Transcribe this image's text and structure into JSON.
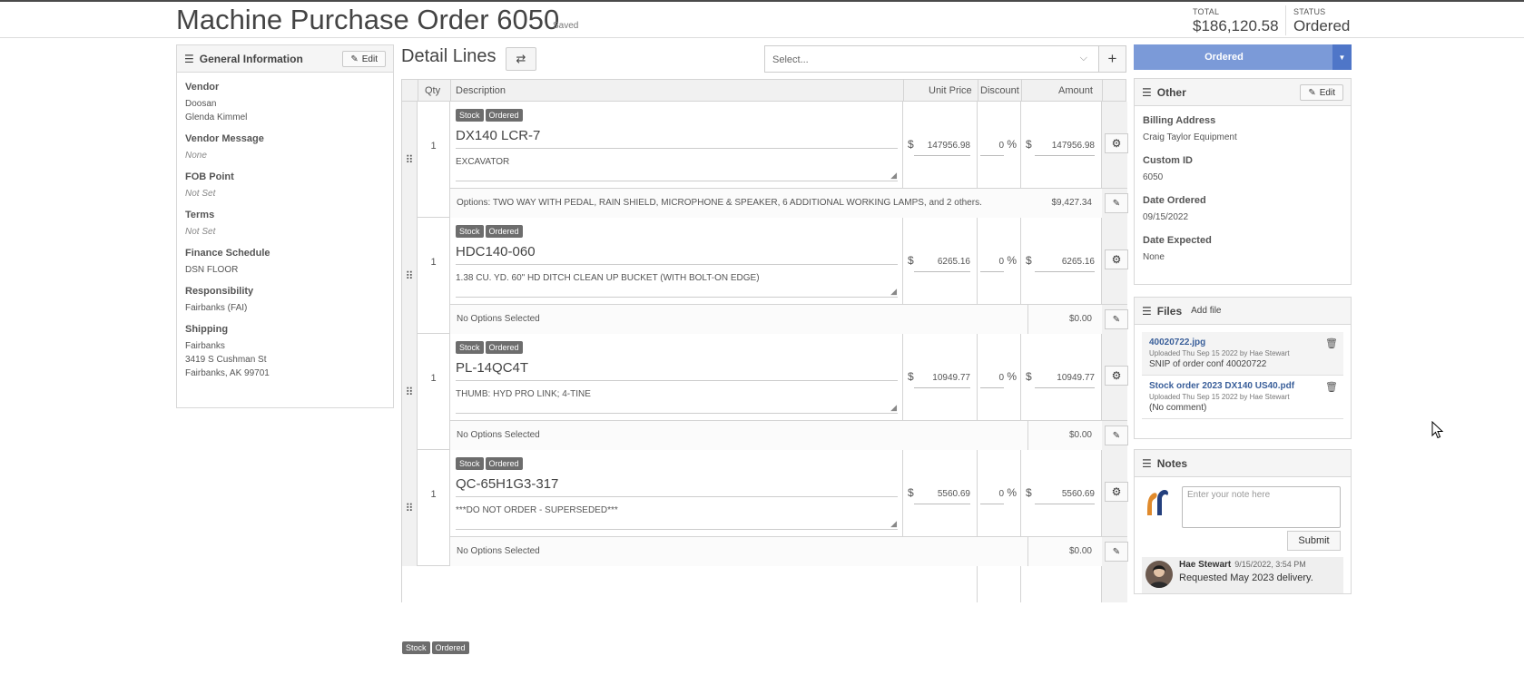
{
  "header": {
    "title": "Machine Purchase Order 6050",
    "saved": "Saved",
    "total_label": "TOTAL",
    "total_value": "$186,120.58",
    "status_label": "STATUS",
    "status_value": "Ordered"
  },
  "general": {
    "title": "General Information",
    "edit": "Edit",
    "vendor_label": "Vendor",
    "vendor_name": "Doosan",
    "vendor_contact": "Glenda Kimmel",
    "vendor_msg_label": "Vendor Message",
    "vendor_msg": "None",
    "fob_label": "FOB Point",
    "fob": "Not Set",
    "terms_label": "Terms",
    "terms": "Not Set",
    "finance_label": "Finance Schedule",
    "finance": "DSN FLOOR",
    "resp_label": "Responsibility",
    "resp": "Fairbanks (FAI)",
    "ship_label": "Shipping",
    "ship_1": "Fairbanks",
    "ship_2": "3419 S Cushman St",
    "ship_3": "Fairbanks, AK 99701"
  },
  "detail": {
    "title": "Detail Lines",
    "select_placeholder": "Select...",
    "columns": {
      "qty": "Qty",
      "description": "Description",
      "unit_price": "Unit Price",
      "discount": "Discount",
      "amount": "Amount"
    },
    "badges": [
      "Stock",
      "Ordered"
    ],
    "items": [
      {
        "qty": "1",
        "part": "DX140 LCR-7",
        "desc": "EXCAVATOR",
        "unit_price": "147956.98",
        "discount": "0",
        "amount": "147956.98",
        "options": "Options: TWO WAY WITH PEDAL, RAIN SHIELD, MICROPHONE & SPEAKER, 6 ADDITIONAL WORKING LAMPS, and 2 others.",
        "options_amount": "$9,427.34"
      },
      {
        "qty": "1",
        "part": "HDC140-060",
        "desc": "1.38 CU. YD. 60\" HD DITCH CLEAN UP BUCKET (WITH BOLT-ON EDGE)",
        "unit_price": "6265.16",
        "discount": "0",
        "amount": "6265.16",
        "options": "No Options Selected",
        "options_amount": "$0.00"
      },
      {
        "qty": "1",
        "part": "PL-14QC4T",
        "desc": "THUMB: HYD PRO LINK; 4-TINE",
        "unit_price": "10949.77",
        "discount": "0",
        "amount": "10949.77",
        "options": "No Options Selected",
        "options_amount": "$0.00"
      },
      {
        "qty": "1",
        "part": "QC-65H1G3-317",
        "desc": "***DO NOT ORDER - SUPERSEDED***",
        "unit_price": "5560.69",
        "discount": "0",
        "amount": "5560.69",
        "options": "No Options Selected",
        "options_amount": "$0.00"
      }
    ],
    "currency": "$",
    "percent": "%"
  },
  "status_button": "Ordered",
  "other": {
    "title": "Other",
    "edit": "Edit",
    "billing_label": "Billing Address",
    "billing": "Craig Taylor Equipment",
    "custom_id_label": "Custom ID",
    "custom_id": "6050",
    "date_ordered_label": "Date Ordered",
    "date_ordered": "09/15/2022",
    "date_expected_label": "Date Expected",
    "date_expected": "None"
  },
  "files": {
    "title": "Files",
    "add": "Add file",
    "list": [
      {
        "name": "40020722.jpg",
        "meta": "Uploaded Thu Sep 15 2022 by Hae Stewart",
        "comment": "SNIP of order conf 40020722"
      },
      {
        "name": "Stock order 2023 DX140 US40.pdf",
        "meta": "Uploaded Thu Sep 15 2022 by Hae Stewart",
        "comment": "(No comment)"
      }
    ]
  },
  "notes": {
    "title": "Notes",
    "placeholder": "Enter your note here",
    "submit": "Submit",
    "entry_author": "Hae Stewart",
    "entry_time": "9/15/2022, 3:54 PM",
    "entry_text": "Requested May 2023 delivery."
  },
  "colors": {
    "accent": "#7b9ad8",
    "accent_dark": "#4f76c8",
    "badge": "#6d6d6d"
  }
}
